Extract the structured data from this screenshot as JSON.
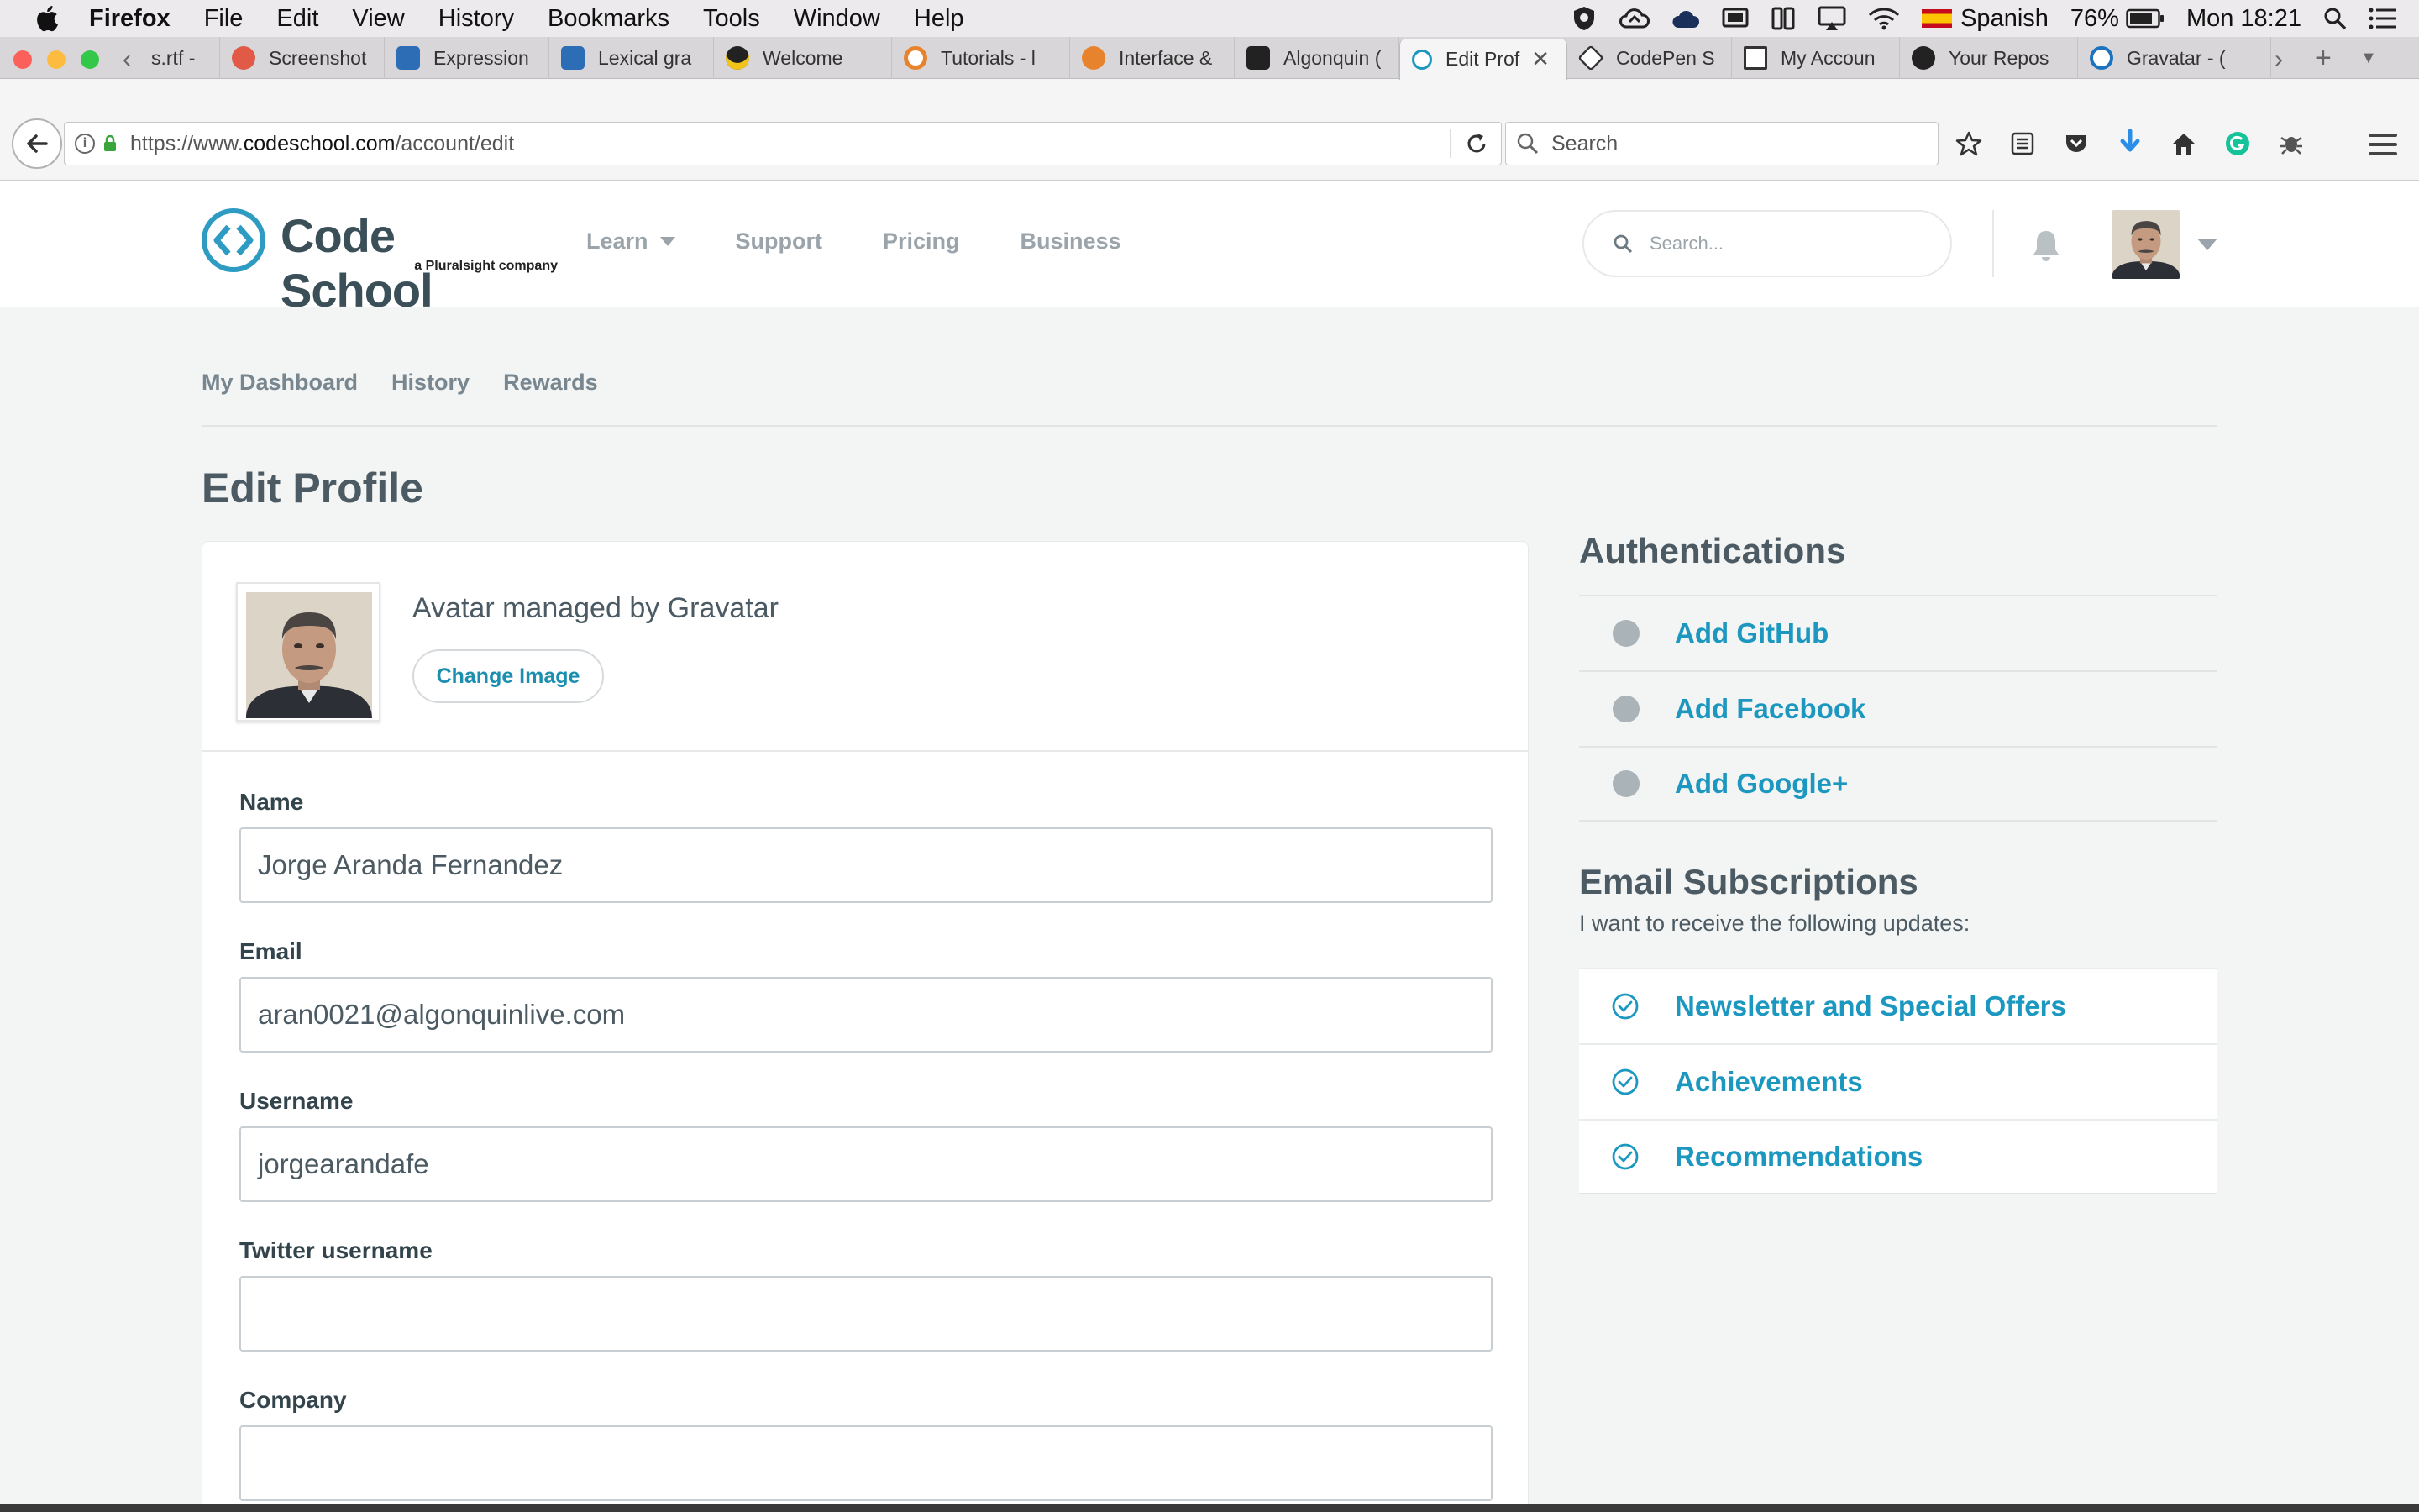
{
  "menubar": {
    "items": [
      "Firefox",
      "File",
      "Edit",
      "View",
      "History",
      "Bookmarks",
      "Tools",
      "Window",
      "Help"
    ],
    "language": "Spanish",
    "battery": "76%",
    "clock": "Mon 18:21"
  },
  "tabs": [
    {
      "label": "s.rtf -",
      "color": "#888888"
    },
    {
      "label": "Screenshot",
      "color": "#e05a47"
    },
    {
      "label": "Expression",
      "color": "#2d6db5"
    },
    {
      "label": "Lexical gra",
      "color": "#2d6db5"
    },
    {
      "label": "Welcome",
      "color": "#222222"
    },
    {
      "label": "Tutorials - l",
      "color": "#e8832d"
    },
    {
      "label": "Interface &",
      "color": "#e8832d"
    },
    {
      "label": "Algonquin (",
      "color": "#222222"
    },
    {
      "label": "Edit Prof",
      "color": "#1c98c0"
    },
    {
      "label": "CodePen S",
      "color": "#333333"
    },
    {
      "label": "My Accoun",
      "color": "#333333"
    },
    {
      "label": "Your Repos",
      "color": "#222222"
    },
    {
      "label": "Gravatar - (",
      "color": "#1e73be"
    }
  ],
  "urlbar": {
    "prefix": "https://www.",
    "host": "codeschool.com",
    "path": "/account/edit"
  },
  "browser_search": {
    "placeholder": "Search"
  },
  "site": {
    "logo_title": "Code School",
    "logo_sub": "a Pluralsight company",
    "nav": [
      "Learn",
      "Support",
      "Pricing",
      "Business"
    ],
    "search_placeholder": "Search..."
  },
  "subnav": [
    "My Dashboard",
    "History",
    "Rewards"
  ],
  "page_title": "Edit Profile",
  "profile": {
    "avatar_text": "Avatar managed by Gravatar",
    "change_image": "Change Image",
    "fields": [
      {
        "label": "Name",
        "value": "Jorge Aranda Fernandez"
      },
      {
        "label": "Email",
        "value": "aran0021@algonquinlive.com"
      },
      {
        "label": "Username",
        "value": "jorgearandafe"
      },
      {
        "label": "Twitter username",
        "value": ""
      },
      {
        "label": "Company",
        "value": ""
      }
    ]
  },
  "authentications": {
    "title": "Authentications",
    "items": [
      "Add GitHub",
      "Add Facebook",
      "Add Google+"
    ]
  },
  "subscriptions": {
    "title": "Email Subscriptions",
    "subtitle": "I want to receive the following updates:",
    "items": [
      "Newsletter and Special Offers",
      "Achievements",
      "Recommendations"
    ]
  },
  "colors": {
    "accent": "#1c98c0",
    "brand": "#3b4f59"
  }
}
